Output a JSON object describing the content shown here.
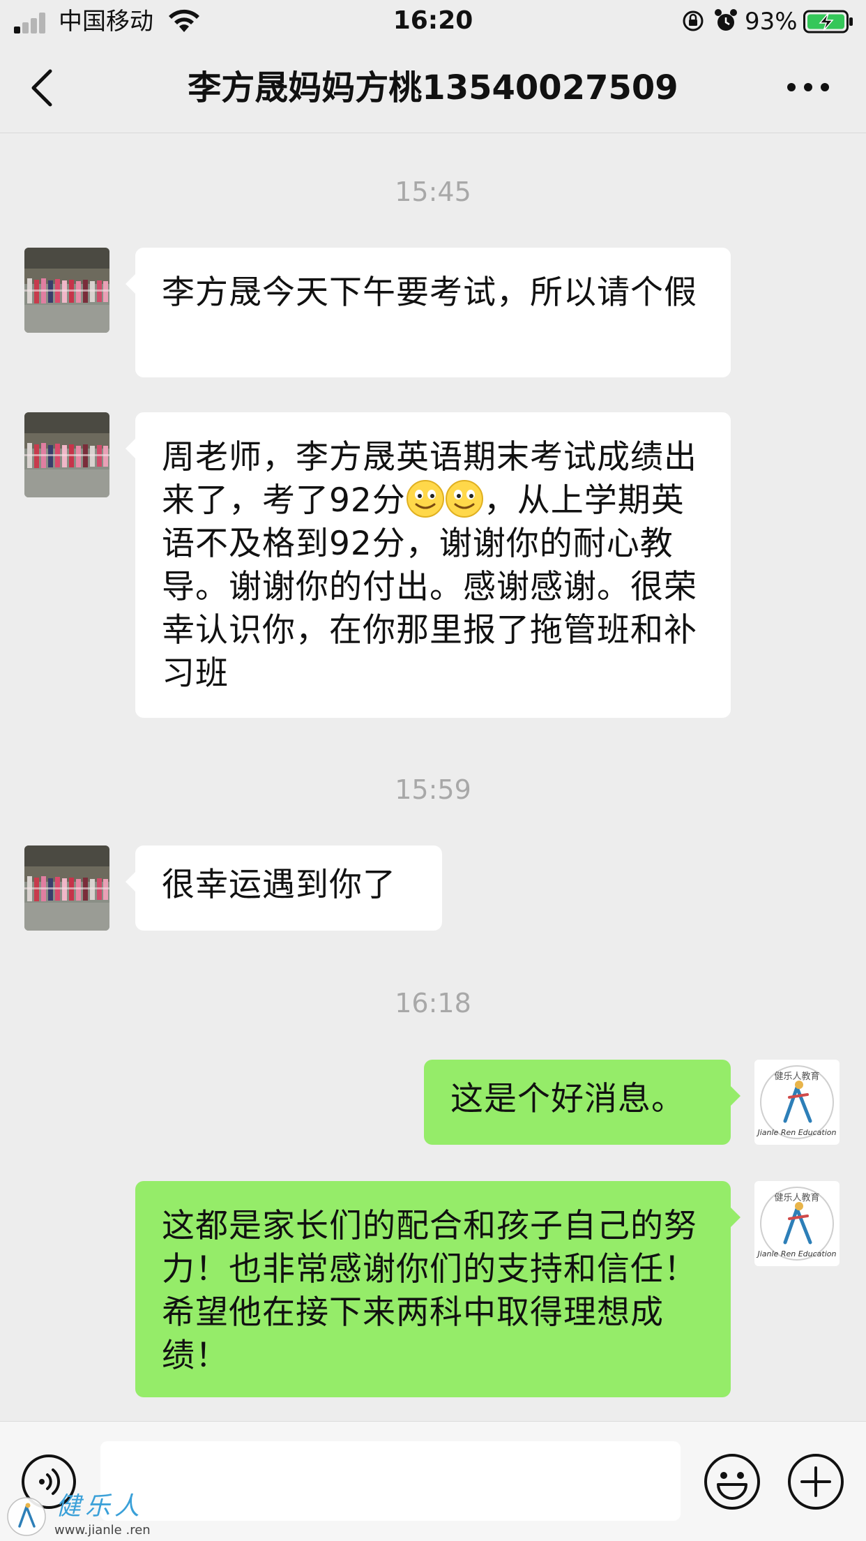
{
  "status_bar": {
    "carrier": "中国移动",
    "time": "16:20",
    "battery_percent": "93%"
  },
  "header": {
    "title": "李方晟妈妈方桃13540027509"
  },
  "messages": {
    "ts1": "15:45",
    "m1": "李方晟今天下午要考试，所以请个假",
    "m2_a": "周老师，李方晟英语期末考试成绩出来了，考了92分",
    "m2_b": "，从上学期英语不及格到92分，谢谢你的耐心教导。谢谢你的付出。感谢感谢。很荣幸认识你，在你那里报了拖管班和补习班",
    "ts2": "15:59",
    "m3": "很幸运遇到你了",
    "ts3": "16:18",
    "m4": "这是个好消息。",
    "m5": "这都是家长们的配合和孩子自己的努力！也非常感谢你们的支持和信任！希望他在接下来两科中取得理想成绩！"
  },
  "icons": {
    "back": "chevron-left-icon",
    "more": "more-dots-icon",
    "voice": "voice-icon",
    "emoji": "emoji-icon",
    "plus": "plus-icon"
  },
  "colors": {
    "outgoing_bubble": "#95ec69",
    "incoming_bubble": "#ffffff",
    "background": "#ededed"
  },
  "watermark": {
    "brand": "健乐人",
    "url": "www.jianle .ren"
  }
}
